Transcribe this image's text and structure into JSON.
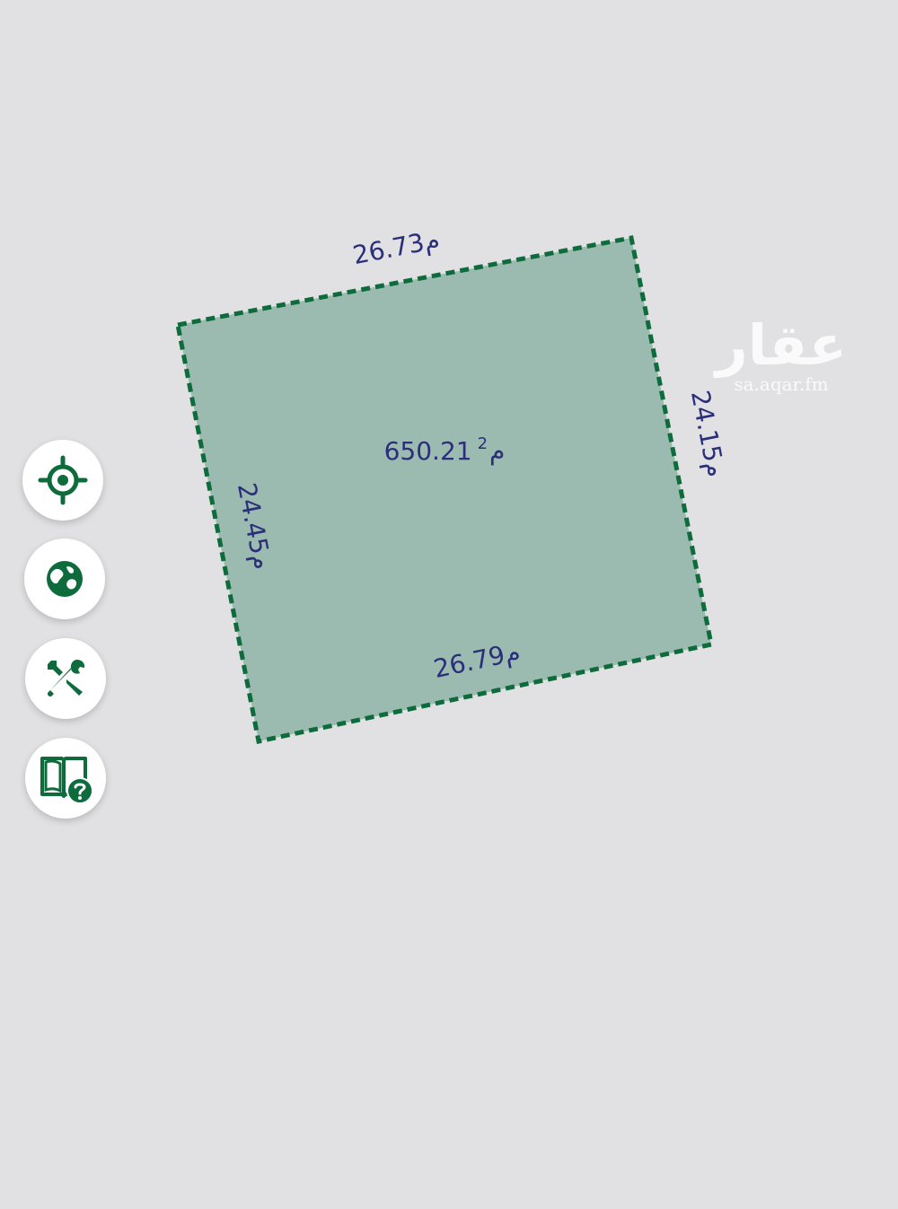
{
  "parcel": {
    "area_value": "650.21",
    "area_unit": "م",
    "area_exp": "2",
    "side_top": "26.73م",
    "side_right": "24.15م",
    "side_bottom": "26.79م",
    "side_left": "24.45م"
  },
  "watermark": {
    "arabic": "عقار",
    "url": "sa.aqar.fm"
  },
  "tools": [
    {
      "name": "locate",
      "icon": "crosshair-icon"
    },
    {
      "name": "basemap",
      "icon": "globe-icon"
    },
    {
      "name": "tools",
      "icon": "wrench-screwdriver-icon"
    },
    {
      "name": "help",
      "icon": "book-help-icon"
    }
  ],
  "colors": {
    "parcel_fill": "#9cbbb0",
    "parcel_stroke": "#0e6b3c",
    "label": "#2b2f7a",
    "icon": "#0e6b3c",
    "background": "#e1e1e3"
  }
}
